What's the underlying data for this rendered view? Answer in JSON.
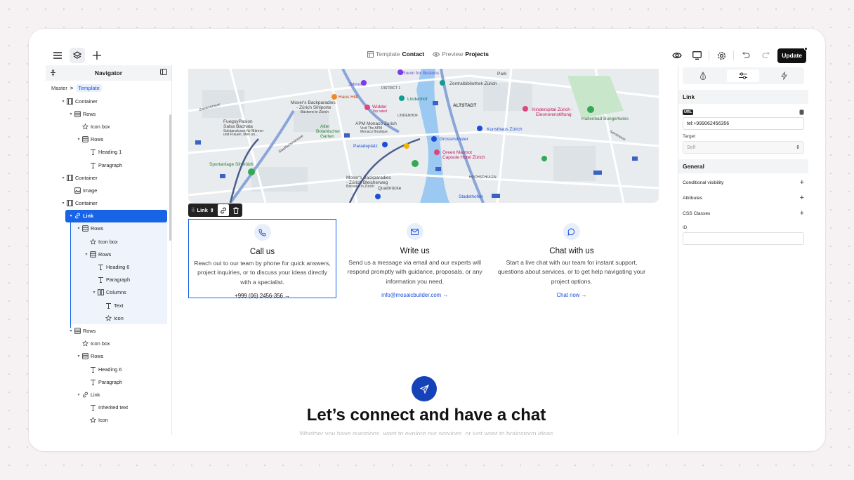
{
  "topbar": {
    "center": {
      "template_prefix": "Template",
      "template_name": "Contact",
      "preview_prefix": "Preview",
      "preview_name": "Projects"
    },
    "update_label": "Update"
  },
  "navigator": {
    "title": "Navigator",
    "breadcrumb": {
      "master": "Master",
      "sep": ">",
      "current": "Template"
    },
    "tree": [
      {
        "label": "Container",
        "icon": "container-icon",
        "depth": 1,
        "arrow": "down"
      },
      {
        "label": "Rows",
        "icon": "rows-icon",
        "depth": 2,
        "arrow": "down"
      },
      {
        "label": "Icon box",
        "icon": "star-icon",
        "depth": 3,
        "arrow": ""
      },
      {
        "label": "Rows",
        "icon": "rows-icon",
        "depth": 3,
        "arrow": "down"
      },
      {
        "label": "Heading 1",
        "icon": "text-icon",
        "depth": 4,
        "arrow": ""
      },
      {
        "label": "Paragraph",
        "icon": "text-icon",
        "depth": 4,
        "arrow": ""
      },
      {
        "label": "Container",
        "icon": "container-icon",
        "depth": 1,
        "arrow": "down"
      },
      {
        "label": "Image",
        "icon": "image-icon",
        "depth": 2,
        "arrow": ""
      },
      {
        "label": "Container",
        "icon": "container-icon",
        "depth": 1,
        "arrow": "down"
      },
      {
        "label": "Link",
        "icon": "link-icon",
        "depth": 2,
        "arrow": "down",
        "state": "sel"
      },
      {
        "label": "Rows",
        "icon": "rows-icon",
        "depth": 3,
        "arrow": "down",
        "state": "insel"
      },
      {
        "label": "Icon box",
        "icon": "star-icon",
        "depth": 4,
        "arrow": "",
        "state": "insel"
      },
      {
        "label": "Rows",
        "icon": "rows-icon",
        "depth": 4,
        "arrow": "down",
        "state": "insel"
      },
      {
        "label": "Heading 6",
        "icon": "text-icon",
        "depth": 5,
        "arrow": "",
        "state": "insel"
      },
      {
        "label": "Paragraph",
        "icon": "text-icon",
        "depth": 5,
        "arrow": "",
        "state": "insel"
      },
      {
        "label": "Columns",
        "icon": "columns-icon",
        "depth": 5,
        "arrow": "down",
        "state": "insel"
      },
      {
        "label": "Text",
        "icon": "text-icon",
        "depth": 6,
        "arrow": "",
        "state": "insel"
      },
      {
        "label": "Icon",
        "icon": "star-icon",
        "depth": 6,
        "arrow": "",
        "state": "insel"
      },
      {
        "label": "Rows",
        "icon": "rows-icon",
        "depth": 2,
        "arrow": "down"
      },
      {
        "label": "Icon box",
        "icon": "star-icon",
        "depth": 3,
        "arrow": ""
      },
      {
        "label": "Rows",
        "icon": "rows-icon",
        "depth": 3,
        "arrow": "down"
      },
      {
        "label": "Heading 6",
        "icon": "text-icon",
        "depth": 4,
        "arrow": ""
      },
      {
        "label": "Paragraph",
        "icon": "text-icon",
        "depth": 4,
        "arrow": ""
      },
      {
        "label": "Link",
        "icon": "link-icon",
        "depth": 3,
        "arrow": "down"
      },
      {
        "label": "Inherited text",
        "icon": "text-icon",
        "depth": 4,
        "arrow": ""
      },
      {
        "label": "Icon",
        "icon": "star-icon",
        "depth": 4,
        "arrow": ""
      }
    ]
  },
  "map": {
    "labels": [
      "Room for Illusions",
      "Park",
      "Jelmoli",
      "DISTRICT 1",
      "Zentralbibliothek Zürich",
      "Moser's Backparadies - Zürich Sihlporte",
      "Bäckerei in Zürich",
      "Haus Hiltl",
      "Lindenhof",
      "Widder",
      "Top rated",
      "ALTSTADT",
      "LINDENHOF",
      "Kinderspital Zürich - Eleonorenstiftung",
      "Hallenbad Bungertwies",
      "FuegoyPasion Salsa Bachata",
      "Solotanzkurse für Männer und Frauen",
      "APM Monaco Zurich",
      "Visit The APM Monaco Boutique",
      "Alter Botanischer Garten",
      "Kunsthaus Zürich",
      "Paradeplatz",
      "Grossmünster",
      "Green Marmot Capsule Hotel Zürich",
      "Sportanlage Sihlhölzli",
      "Moser's Backparadies - Zürich Bleicherweg",
      "Quaibrücke",
      "HOCHSCHULEN",
      "Stadelhofen",
      "Zweierstrasse",
      "Stauffacherstrasse",
      "Seestrasse"
    ]
  },
  "element_toolbar": {
    "label": "Link"
  },
  "cards": [
    {
      "title": "Call us",
      "text": "Reach out to our team by phone for quick answers, project inquiries, or to discuss your ideas directly with a specialist.",
      "link": "+999 (06) 2456-356",
      "icon": "phone-icon"
    },
    {
      "title": "Write us",
      "text": "Send us a message via email and our experts will respond promptly with guidance, proposals, or any information you need.",
      "link": "info@mosaicbuilder.com",
      "icon": "mail-icon"
    },
    {
      "title": "Chat with us",
      "text": "Start a live chat with our team for instant support, questions about services, or to get help navigating your project options.",
      "link": "Chat now",
      "icon": "chat-icon"
    }
  ],
  "cta": {
    "headline": "Let’s connect and have a chat",
    "subtext": "Whether you have questions, want to explore our services, or just want to brainstorm ideas"
  },
  "panel": {
    "link_section": "Link",
    "url_tag": "URL",
    "url_value": "tel:+999062456356",
    "target_label": "Target",
    "target_value": "Self",
    "general_section": "General",
    "rows": [
      {
        "label": "Conditional visibility"
      },
      {
        "label": "Attributes"
      },
      {
        "label": "CSS Classes"
      }
    ],
    "id_label": "ID",
    "id_value": ""
  },
  "colors": {
    "accent": "#1864e6",
    "dark": "#111111",
    "link": "#1d4ed8",
    "fab": "#1542b8"
  }
}
